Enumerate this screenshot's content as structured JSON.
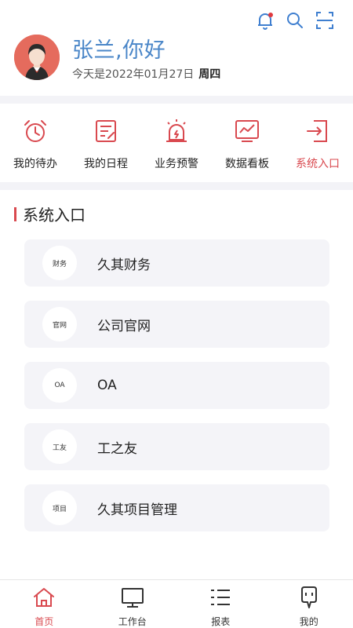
{
  "header": {
    "greeting": "张兰,你好",
    "date_text": "今天是2022年01月27日",
    "weekday": "周四",
    "icons": [
      "bell-icon",
      "search-icon",
      "scan-icon"
    ],
    "notification_dot_color": "#e0393e"
  },
  "quick_nav": {
    "items": [
      {
        "label": "我的待办",
        "icon": "alarm-clock-icon"
      },
      {
        "label": "我的日程",
        "icon": "schedule-doc-icon"
      },
      {
        "label": "业务预警",
        "icon": "warning-light-icon"
      },
      {
        "label": "数据看板",
        "icon": "chart-board-icon"
      },
      {
        "label": "系统入口",
        "icon": "system-entry-icon",
        "active": true
      }
    ]
  },
  "section": {
    "title": "系统入口"
  },
  "entries": [
    {
      "badge": "财务",
      "name": "久其财务"
    },
    {
      "badge": "官网",
      "name": "公司官网"
    },
    {
      "badge": "OA",
      "name": "OA"
    },
    {
      "badge": "工友",
      "name": "工之友"
    },
    {
      "badge": "项目",
      "name": "久其项目管理"
    }
  ],
  "tabbar": {
    "tabs": [
      {
        "label": "首页",
        "icon": "home-icon",
        "active": true
      },
      {
        "label": "工作台",
        "icon": "monitor-icon"
      },
      {
        "label": "报表",
        "icon": "list-icon"
      },
      {
        "label": "我的",
        "icon": "profile-icon"
      }
    ]
  },
  "colors": {
    "accent": "#d9494f",
    "greeting_blue": "#4a86c8",
    "icon_blue": "#3f7fd0",
    "card_bg": "#f4f4f8"
  }
}
